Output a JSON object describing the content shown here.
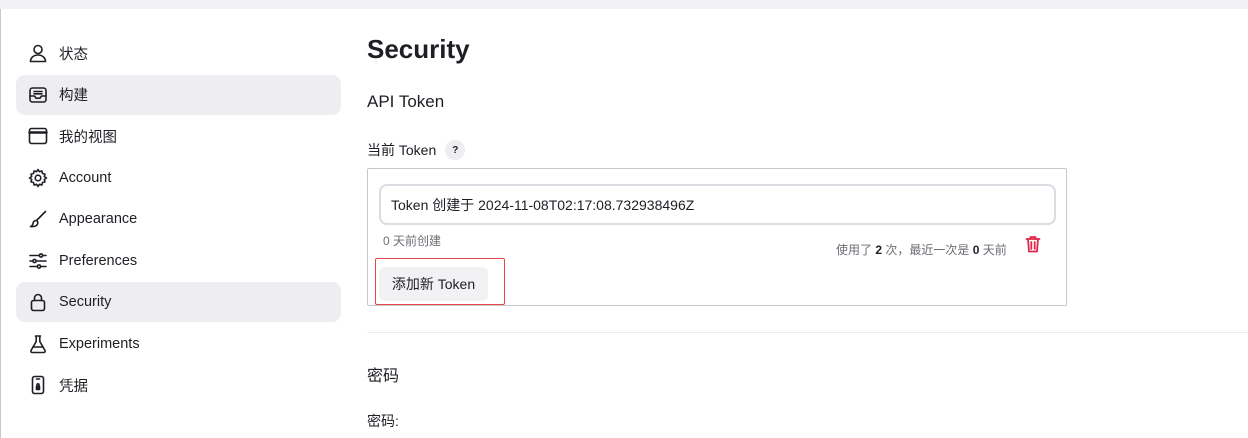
{
  "sidebar": {
    "items": [
      {
        "label": "状态",
        "icon": "person-icon",
        "active": false
      },
      {
        "label": "构建",
        "icon": "inbox-icon",
        "active": true
      },
      {
        "label": "我的视图",
        "icon": "window-icon",
        "active": false
      },
      {
        "label": "Account",
        "icon": "gear-icon",
        "active": false
      },
      {
        "label": "Appearance",
        "icon": "brush-icon",
        "active": false
      },
      {
        "label": "Preferences",
        "icon": "sliders-icon",
        "active": false
      },
      {
        "label": "Security",
        "icon": "lock-icon",
        "active": true
      },
      {
        "label": "Experiments",
        "icon": "flask-icon",
        "active": false
      },
      {
        "label": "凭据",
        "icon": "device-icon",
        "active": false
      }
    ]
  },
  "main": {
    "title": "Security",
    "api_token": {
      "heading": "API Token",
      "current_label": "当前 Token",
      "help": "?",
      "token_value": "Token 创建于 2024-11-08T02:17:08.732938496Z",
      "created": "0 天前创建",
      "usage": {
        "prefix": "使用了",
        "count": "2",
        "middle": "次，最近一次是",
        "days": "0",
        "suffix": "天前"
      },
      "add_button": "添加新 Token"
    },
    "password": {
      "heading": "密码",
      "label": "密码:"
    }
  },
  "colors": {
    "active_bg": "#eeeef2",
    "danger": "#e0284a",
    "highlight_border": "#e5484d"
  }
}
